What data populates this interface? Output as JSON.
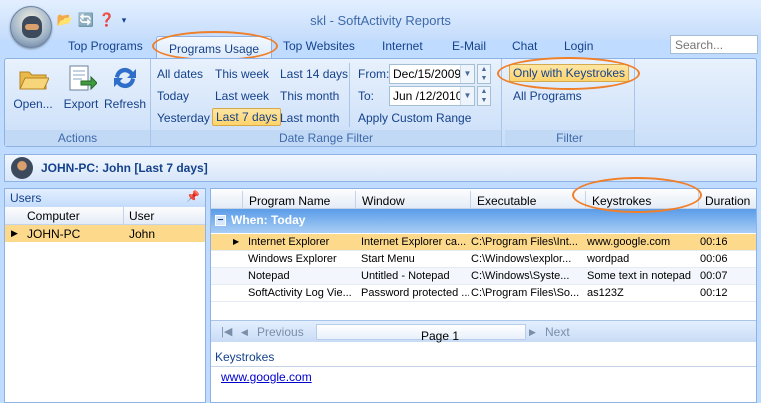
{
  "window": {
    "title": "skl - SoftActivity Reports"
  },
  "qat": [
    {
      "icon": "folder-open-icon",
      "glyph": "📂"
    },
    {
      "icon": "refresh-icon",
      "glyph": "🔄"
    },
    {
      "icon": "help-icon",
      "glyph": "❓"
    }
  ],
  "tabs": [
    "Top Programs",
    "Programs Usage",
    "Top Websites",
    "Internet",
    "E-Mail",
    "Chat",
    "Login"
  ],
  "active_tab": "Programs Usage",
  "search": {
    "placeholder": "Search..."
  },
  "ribbon": {
    "actions": {
      "label": "Actions",
      "open": "Open...",
      "export": "Export",
      "refresh": "Refresh"
    },
    "date_filter": {
      "label": "Date Range Filter",
      "all_dates": "All dates",
      "this_week": "This week",
      "last_14_days": "Last 14 days",
      "today": "Today",
      "last_week": "Last week",
      "this_month": "This month",
      "yesterday": "Yesterday",
      "last_7_days": "Last 7 days",
      "last_month": "Last month",
      "from_label": "From:",
      "from_value": "Dec/15/2009",
      "to_label": "To:",
      "to_value": "Jun /12/2010",
      "apply": "Apply Custom Range"
    },
    "filter": {
      "label": "Filter",
      "only_keystrokes": "Only with Keystrokes",
      "all_programs": "All Programs"
    }
  },
  "userbar": {
    "text": "JOHN-PC: John [Last 7 days]"
  },
  "users_panel": {
    "title": "Users",
    "columns": [
      "Computer",
      "User"
    ],
    "rows": [
      {
        "computer": "JOHN-PC",
        "user": "John"
      }
    ]
  },
  "grid": {
    "columns": [
      "Program Name",
      "Window",
      "Executable",
      "Keystrokes",
      "Duration"
    ],
    "group": "When: Today",
    "rows": [
      {
        "program": "Internet Explorer",
        "window": "Internet Explorer ca...",
        "exe": "C:\\Program Files\\Int...",
        "keys": "www.google.com",
        "duration": "00:16"
      },
      {
        "program": "Windows Explorer",
        "window": "Start Menu",
        "exe": "C:\\Windows\\explor...",
        "keys": "wordpad",
        "duration": "00:06"
      },
      {
        "program": "Notepad",
        "window": "Untitled - Notepad",
        "exe": "C:\\Windows\\Syste...",
        "keys": "Some text in notepad",
        "duration": "00:07"
      },
      {
        "program": "SoftActivity Log Vie...",
        "window": "Password protected ...",
        "exe": "C:\\Program Files\\So...",
        "keys": "as123Z",
        "duration": "00:12"
      }
    ]
  },
  "pager": {
    "previous": "Previous",
    "page": "Page 1",
    "next": "Next"
  },
  "keystrokes_panel": {
    "title": "Keystrokes",
    "value": "www.google.com"
  },
  "colors": {
    "highlight_oval": "#f07f2a",
    "selection": "#fdd98b",
    "group_header": "#5a9ce8"
  }
}
